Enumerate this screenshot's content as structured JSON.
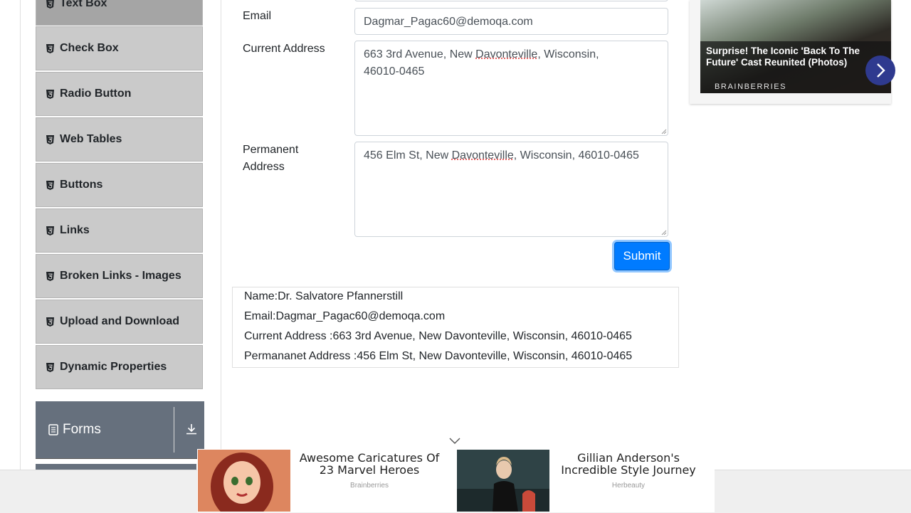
{
  "sidebar": {
    "items": [
      {
        "label": "Text Box"
      },
      {
        "label": "Check Box"
      },
      {
        "label": "Radio Button"
      },
      {
        "label": "Web Tables"
      },
      {
        "label": "Buttons"
      },
      {
        "label": "Links"
      },
      {
        "label": "Broken Links - Images"
      },
      {
        "label": "Upload and Download"
      },
      {
        "label": "Dynamic Properties"
      }
    ],
    "group": {
      "label": "Forms",
      "icon": "document-icon",
      "toggle_icon": "download-icon"
    }
  },
  "form": {
    "email": {
      "label": "Email",
      "value": "Dagmar_Pagac60@demoqa.com"
    },
    "current_address": {
      "label": "Current Address",
      "line1_a": "663 3rd Avenue, New ",
      "line1_b": "Davonteville",
      "line1_c": ", Wisconsin,",
      "line2": "46010-0465"
    },
    "permanent_address": {
      "label_line1": "Permanent",
      "label_line2": "Address",
      "part_a": "456 Elm St, New ",
      "part_b": "Davonteville",
      "part_c": ", Wisconsin, 46010-0465"
    },
    "submit_label": "Submit"
  },
  "output": {
    "name": "Name:Dr. Salvatore Pfannerstill",
    "email": "Email:Dagmar_Pagac60@demoqa.com",
    "current_address": "Current Address :663 3rd Avenue, New Davonteville, Wisconsin, 46010-0465",
    "permanent_address": "Permananet Address :456 Elm St, New Davonteville, Wisconsin, 46010-0465"
  },
  "ads": {
    "top": {
      "title": "Surprise! The Iconic 'Back To The Future' Cast Reunited (Photos)",
      "source": "BRAINBERRIES"
    },
    "bottom": [
      {
        "title": "Awesome Caricatures Of 23 Marvel Heroes",
        "source": "Brainberries"
      },
      {
        "title": "Gillian Anderson's Incredible Style Journey",
        "source": "Herbeauty"
      }
    ]
  },
  "colors": {
    "primary": "#007bff",
    "menu_bg": "#cacaca",
    "group_bg": "#66707d"
  }
}
